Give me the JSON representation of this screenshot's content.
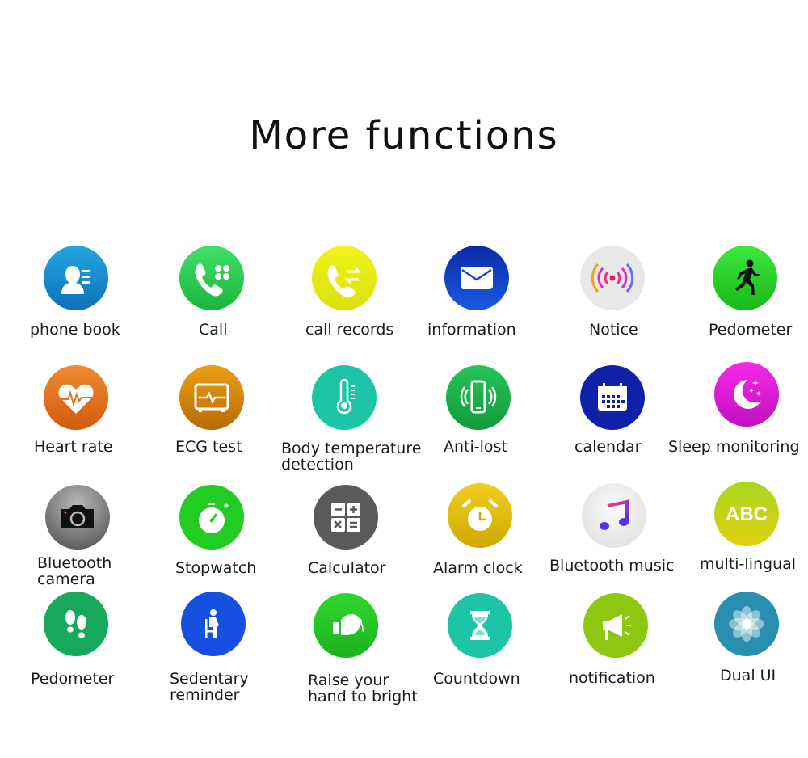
{
  "title": "More functions",
  "functions": [
    {
      "label": "phone book",
      "icon": "contact-card-icon",
      "color": "#1a8ad0"
    },
    {
      "label": "Call",
      "icon": "phone-dialpad-icon",
      "color": "#2dcb4c"
    },
    {
      "label": "call records",
      "icon": "phone-transfer-icon",
      "color": "#e6ec12"
    },
    {
      "label": "information",
      "icon": "envelope-icon",
      "color": "#1446c8"
    },
    {
      "label": "Notice",
      "icon": "broadcast-signal-icon",
      "color": "#e8e8e8"
    },
    {
      "label": "Pedometer",
      "icon": "running-person-icon",
      "color": "#2ed02e"
    },
    {
      "label": "Heart rate",
      "icon": "heart-pulse-icon",
      "color": "#e8731f"
    },
    {
      "label": "ECG test",
      "icon": "ecg-monitor-icon",
      "color": "#d98a0a"
    },
    {
      "label": "Body temperature",
      "label2": "detection",
      "icon": "thermometer-icon",
      "color": "#1ec4a6"
    },
    {
      "label": "Anti-lost",
      "icon": "vibrating-phone-icon",
      "color": "#1fb54e"
    },
    {
      "label": "calendar",
      "icon": "calendar-icon",
      "color": "#0f21a8"
    },
    {
      "label": "Sleep monitoring",
      "icon": "moon-stars-icon",
      "color": "#e51ad8"
    },
    {
      "label": "Bluetooth",
      "label2": "camera",
      "icon": "camera-icon",
      "color": "#7a7a7a"
    },
    {
      "label": "Stopwatch",
      "icon": "stopwatch-icon",
      "color": "#22cc22"
    },
    {
      "label": "Calculator",
      "icon": "calculator-icon",
      "color": "#5a5a5a"
    },
    {
      "label": "Alarm clock",
      "icon": "alarm-clock-icon",
      "color": "#e6c20a"
    },
    {
      "label": "Bluetooth music",
      "icon": "music-note-icon",
      "color": "#ececec"
    },
    {
      "label": "multi-lingual",
      "icon": "abc-text-icon",
      "color": "#b8d40e"
    },
    {
      "label": "Pedometer",
      "icon": "footprints-icon",
      "color": "#17a85c"
    },
    {
      "label": "Sedentary",
      "label2": "reminder",
      "icon": "seated-person-icon",
      "color": "#1550e0"
    },
    {
      "label": "Raise your",
      "label2": "hand to bright",
      "icon": "raised-fist-icon",
      "color": "#27c42a"
    },
    {
      "label": "Countdown",
      "icon": "hourglass-icon",
      "color": "#1ec4a6"
    },
    {
      "label": "notification",
      "icon": "megaphone-icon",
      "color": "#8cc812"
    },
    {
      "label": "Dual UI",
      "icon": "flower-petals-icon",
      "color": "#2a8eb0"
    }
  ]
}
